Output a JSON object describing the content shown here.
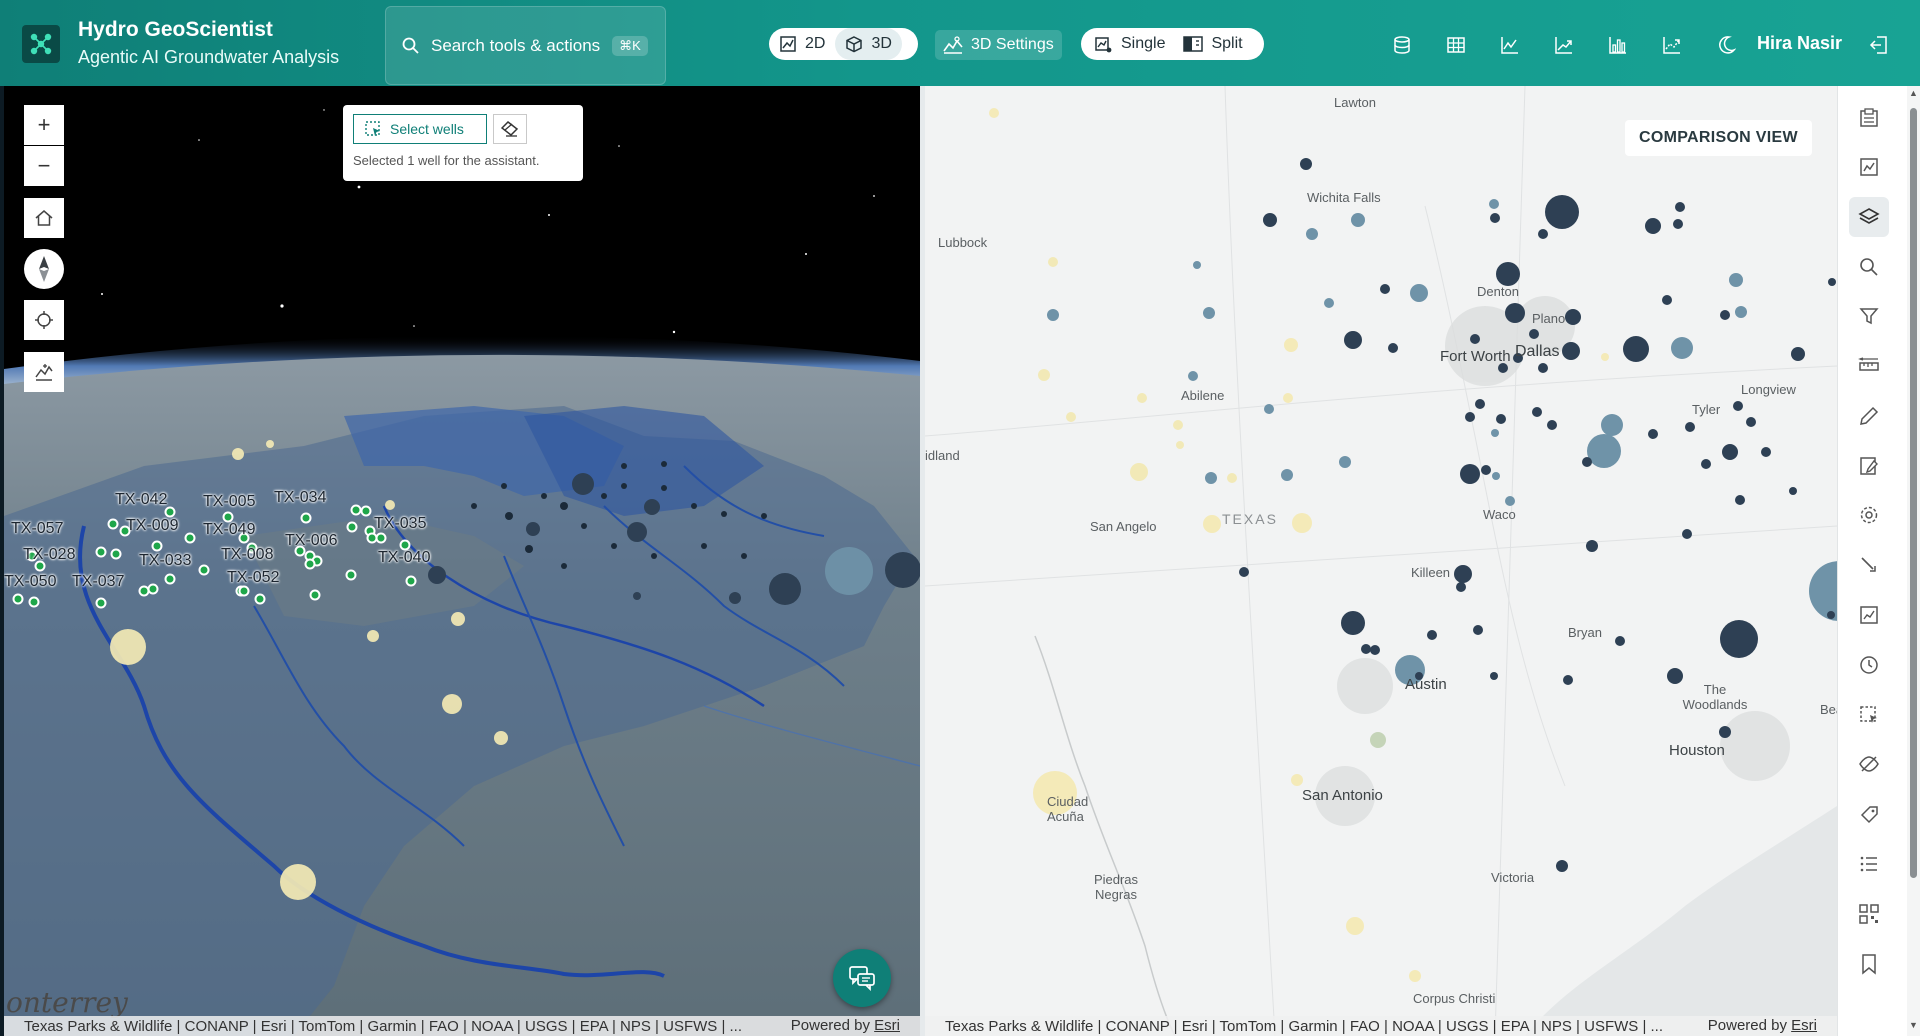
{
  "app": {
    "title": "Hydro GeoScientist",
    "subtitle": "Agentic AI Groundwater Analysis"
  },
  "search": {
    "label": "Search tools & actions",
    "shortcut": "⌘K"
  },
  "view_modes": {
    "two_d": "2D",
    "three_d": "3D",
    "settings_3d": "3D Settings"
  },
  "layout_modes": {
    "single": "Single",
    "split": "Split"
  },
  "header_icons": [
    "database-icon",
    "table-icon",
    "line-chart-icon",
    "trend-chart-icon",
    "bar-chart-icon",
    "forecast-chart-icon",
    "moon-icon"
  ],
  "user": {
    "name": "Hira Nasir"
  },
  "map_controls": [
    "zoom-in",
    "zoom-out",
    "home",
    "compass",
    "locate",
    "elevation-profile"
  ],
  "zoom": {
    "in": "+",
    "out": "−"
  },
  "select_tool": {
    "button_label": "Select wells",
    "message": "Selected 1 well for the assistant."
  },
  "left_map": {
    "well_labels": [
      "TX-042",
      "TX-005",
      "TX-034",
      "TX-057",
      "TX-009",
      "TX-049",
      "TX-035",
      "TX-028",
      "TX-033",
      "TX-008",
      "TX-006",
      "TX-040",
      "TX-050",
      "TX-037",
      "TX-052"
    ],
    "city_partial": "onterrey"
  },
  "right_map": {
    "badge": "COMPARISON VIEW",
    "cities": [
      "Lawton",
      "Wichita Falls",
      "Lubbock",
      "Denton",
      "Plano",
      "Fort Worth",
      "Dallas",
      "Abilene",
      "Longview",
      "Tyler",
      "idland",
      "Waco",
      "San Angelo",
      "Killeen",
      "Bryan",
      "Austin",
      "The Woodlands",
      "Houston",
      "Bea",
      "San Antonio",
      "Ciudad Acuña",
      "Piedras Negras",
      "Victoria",
      "Corpus Christi"
    ],
    "state_label": "TEXAS"
  },
  "attribution": {
    "sources": "Texas Parks & Wildlife | CONANP | Esri | TomTom | Garmin | FAO | NOAA | USGS | EPA | NPS | USFWS | ...",
    "powered_by": "Powered by",
    "esri": "Esri"
  },
  "toolbar_icons": [
    "basemap-icon",
    "chart-panel-icon",
    "layers-icon",
    "search-icon",
    "filter-icon",
    "measure-icon",
    "pencil-icon",
    "edit-note-icon",
    "settings-icon",
    "pen-tool-icon",
    "report-icon",
    "history-icon",
    "select-area-icon",
    "eye-off-icon",
    "tag-icon",
    "list-icon",
    "qr-code-icon",
    "bookmark-icon"
  ],
  "colors": {
    "header_start": "#0f7f77",
    "header_end": "#18a394",
    "accent": "#0f7f77",
    "well_green": "#1fa64a",
    "dot_dark": "#2e4054",
    "dot_mid": "#6f93a8",
    "dot_light": "#f3e9b4"
  }
}
